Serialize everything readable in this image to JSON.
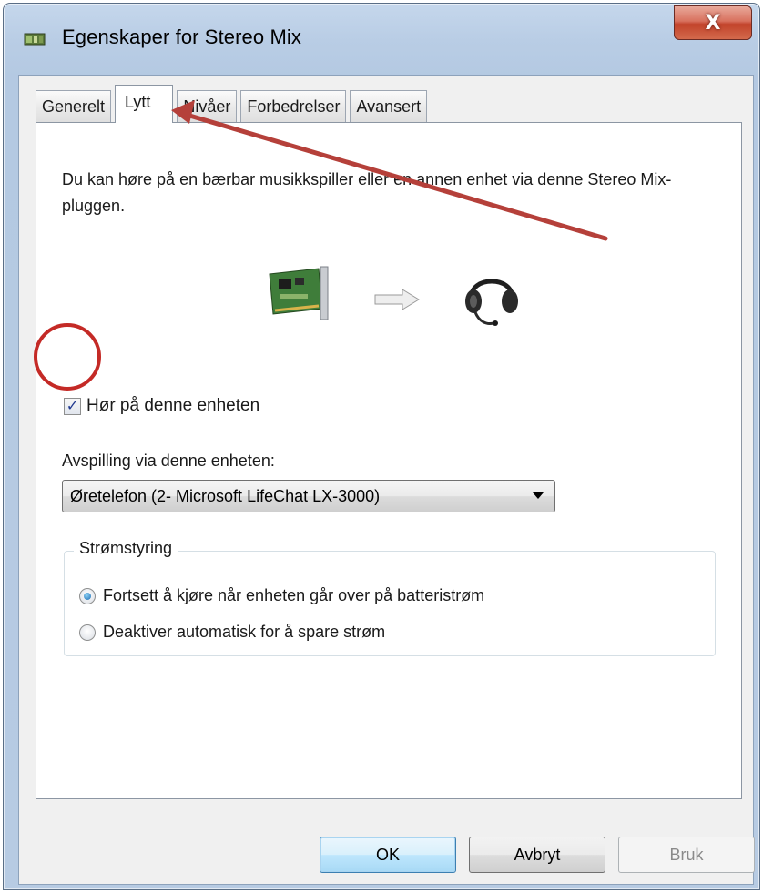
{
  "window": {
    "title": "Egenskaper for Stereo Mix",
    "close_glyph": "X"
  },
  "tabs": [
    {
      "label": "Generelt",
      "active": false
    },
    {
      "label": "Lytt",
      "active": true
    },
    {
      "label": "Nivåer",
      "active": false
    },
    {
      "label": "Forbedrelser",
      "active": false
    },
    {
      "label": "Avansert",
      "active": false
    }
  ],
  "listen": {
    "description": "Du kan høre på en bærbar musikkspiller eller en annen enhet via denne Stereo Mix-pluggen.",
    "icons": [
      "sound-card-icon",
      "arrow-right-icon",
      "headset-icon"
    ],
    "listen_checkbox_label": "Hør på denne enheten",
    "listen_checked": true,
    "playback_label": "Avspilling via denne enheten:",
    "playback_device": "Øretelefon (2- Microsoft LifeChat LX-3000)",
    "power": {
      "legend": "Strømstyring",
      "options": [
        {
          "label": "Fortsett å kjøre når enheten går over på batteristrøm",
          "selected": true
        },
        {
          "label": "Deaktiver automatisk for å spare strøm",
          "selected": false
        }
      ]
    }
  },
  "buttons": {
    "ok": "OK",
    "cancel": "Avbryt",
    "apply": "Bruk"
  },
  "annotations": {
    "color": "#b5403a",
    "items": [
      "arrow-annotation",
      "circle-annotation"
    ]
  }
}
